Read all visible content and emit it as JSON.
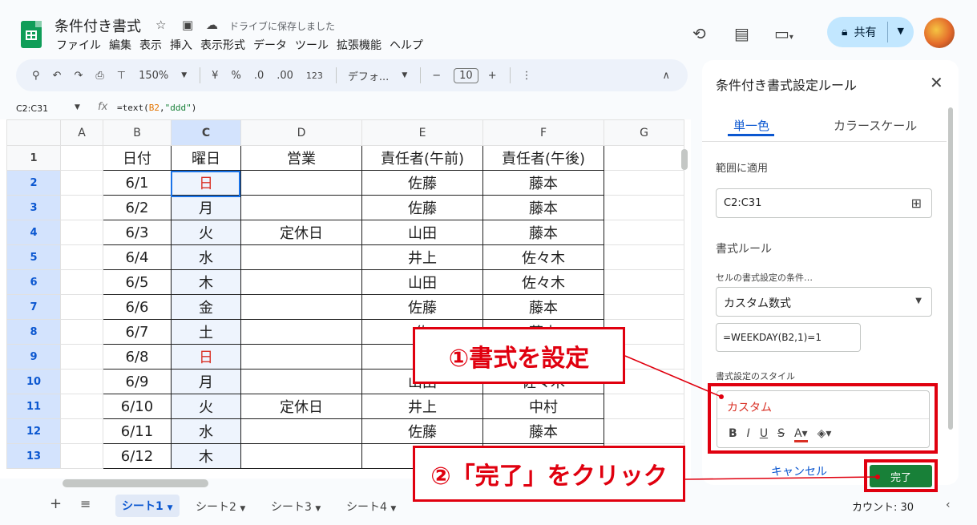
{
  "header": {
    "title": "条件付き書式",
    "saved_status": "ドライブに保存しました",
    "menu": [
      "ファイル",
      "編集",
      "表示",
      "挿入",
      "表示形式",
      "データ",
      "ツール",
      "拡張機能",
      "ヘルプ"
    ],
    "share_label": "共有"
  },
  "toolbar": {
    "zoom": "150%",
    "currency": "¥",
    "percent": "%",
    "decrease_decimal": ".0",
    "increase_decimal": ".00",
    "number_format": "123",
    "font": "デフォ...",
    "font_size": "10"
  },
  "formula_bar": {
    "name_box": "C2:C31",
    "formula_prefix": "=text(",
    "formula_ref": "B2",
    "formula_comma": ",",
    "formula_str": "\"ddd\"",
    "formula_suffix": ")"
  },
  "sheet": {
    "columns": [
      "A",
      "B",
      "C",
      "D",
      "E",
      "F",
      "G"
    ],
    "row_numbers": [
      "1",
      "2",
      "3",
      "4",
      "5",
      "6",
      "7",
      "8",
      "9",
      "10",
      "11",
      "12",
      "13"
    ],
    "rows": [
      [
        "",
        "日付",
        "曜日",
        "営業",
        "責任者(午前)",
        "責任者(午後)",
        ""
      ],
      [
        "",
        "6/1",
        "日",
        "",
        "佐藤",
        "藤本",
        ""
      ],
      [
        "",
        "6/2",
        "月",
        "",
        "佐藤",
        "藤本",
        ""
      ],
      [
        "",
        "6/3",
        "火",
        "定休日",
        "山田",
        "藤本",
        ""
      ],
      [
        "",
        "6/4",
        "水",
        "",
        "井上",
        "佐々木",
        ""
      ],
      [
        "",
        "6/5",
        "木",
        "",
        "山田",
        "佐々木",
        ""
      ],
      [
        "",
        "6/6",
        "金",
        "",
        "佐藤",
        "藤本",
        ""
      ],
      [
        "",
        "6/7",
        "土",
        "",
        "佐",
        "藤本",
        ""
      ],
      [
        "",
        "6/8",
        "日",
        "",
        "佐",
        "藤本",
        ""
      ],
      [
        "",
        "6/9",
        "月",
        "",
        "山田",
        "佐々木",
        ""
      ],
      [
        "",
        "6/10",
        "火",
        "定休日",
        "井上",
        "中村",
        ""
      ],
      [
        "",
        "6/11",
        "水",
        "",
        "佐藤",
        "藤本",
        ""
      ],
      [
        "",
        "6/12",
        "木",
        "",
        "井",
        "",
        ""
      ]
    ],
    "red_weekdays": [
      "日"
    ],
    "count_label": "カウント: 30"
  },
  "tabs": [
    "シート1",
    "シート2",
    "シート3",
    "シート4"
  ],
  "panel": {
    "title": "条件付き書式設定ルール",
    "tab_single": "単一色",
    "tab_scale": "カラースケール",
    "range_label": "範囲に適用",
    "range_value": "C2:C31",
    "rules_label": "書式ルール",
    "condition_label": "セルの書式設定の条件…",
    "condition_value": "カスタム数式",
    "formula_value": "=WEEKDAY(B2,1)=1",
    "style_label": "書式設定のスタイル",
    "style_preview": "カスタム",
    "cancel_label": "キャンセル",
    "done_label": "完了"
  },
  "annotations": {
    "step1": "①書式を設定",
    "step2": "②「完了」をクリック"
  },
  "colors": {
    "accent": "#0b57d0",
    "red_text": "#d93025",
    "annotation_red": "#e0000f",
    "done_green": "#188038",
    "selected_header": "#d3e3fd"
  }
}
